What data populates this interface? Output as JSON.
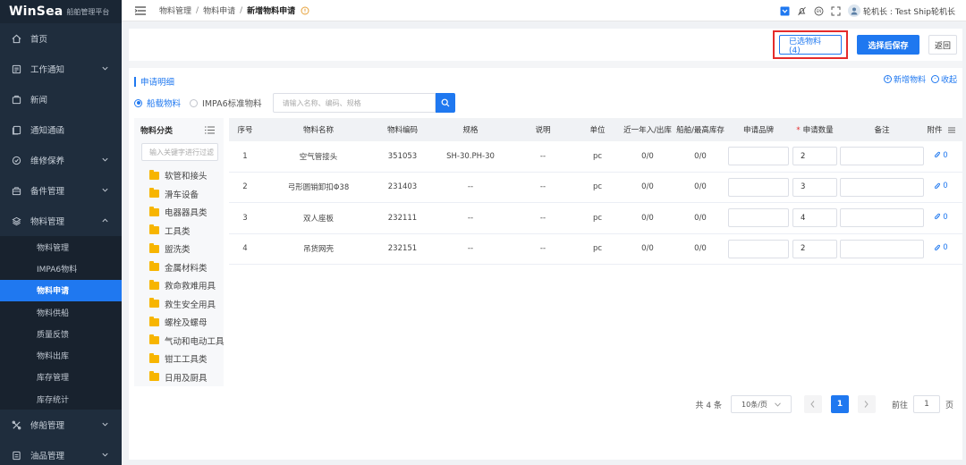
{
  "brand": {
    "logo": "WinSea",
    "subtitle": "船舶管理平台"
  },
  "sidebar": {
    "items": [
      {
        "label": "首页",
        "icon": "home-icon",
        "arrow": false
      },
      {
        "label": "工作通知",
        "icon": "notice-icon",
        "arrow": true
      },
      {
        "label": "新闻",
        "icon": "news-icon",
        "arrow": false
      },
      {
        "label": "通知通函",
        "icon": "circular-icon",
        "arrow": false
      },
      {
        "label": "维修保养",
        "icon": "maintenance-icon",
        "arrow": true
      },
      {
        "label": "备件管理",
        "icon": "spare-parts-icon",
        "arrow": true
      },
      {
        "label": "物料管理",
        "icon": "materials-icon",
        "arrow": true,
        "expanded": true
      }
    ],
    "submenu": [
      {
        "label": "物料管理",
        "active": false
      },
      {
        "label": "IMPA6物料",
        "active": false
      },
      {
        "label": "物料申请",
        "active": true
      },
      {
        "label": "物料供船",
        "active": false
      },
      {
        "label": "质量反馈",
        "active": false
      },
      {
        "label": "物料出库",
        "active": false
      },
      {
        "label": "库存管理",
        "active": false
      },
      {
        "label": "库存统计",
        "active": false
      }
    ],
    "bottom_items": [
      {
        "label": "修船管理",
        "icon": "ship-repair-icon",
        "arrow": true
      },
      {
        "label": "油品管理",
        "icon": "oil-icon",
        "arrow": true
      }
    ]
  },
  "breadcrumb": {
    "items": [
      "物料管理",
      "物料申请",
      "新增物料申请"
    ],
    "separator": "/"
  },
  "topbar": {
    "user": "轮机长 : Test Ship轮机长"
  },
  "actions": {
    "selected_label": "已选物料(4)",
    "save_label": "选择后保存",
    "back_label": "返回"
  },
  "section": {
    "title": "申请明细",
    "add_link": "新增物料",
    "collapse_link": "收起"
  },
  "filter": {
    "options": [
      {
        "label": "船载物料",
        "checked": true
      },
      {
        "label": "IMPA6标准物料",
        "checked": false
      }
    ],
    "search_placeholder": "请输入名称、编码、规格"
  },
  "category": {
    "title": "物料分类",
    "search_placeholder": "输入关键字进行过滤",
    "items": [
      "软管和接头",
      "滑车设备",
      "电器器具类",
      "工具类",
      "盥洗类",
      "金属材料类",
      "救命救难用具",
      "救生安全用具",
      "螺栓及螺母",
      "气动和电动工具",
      "钳工工具类",
      "日用及厨具"
    ]
  },
  "table": {
    "headers": {
      "idx": "序号",
      "name": "物料名称",
      "code": "物料编码",
      "spec": "规格",
      "desc": "说明",
      "unit": "单位",
      "year": "近一年入/出库",
      "max": "船舶/最高库存",
      "brand": "申请品牌",
      "qty": "申请数量",
      "note": "备注",
      "att": "附件"
    },
    "rows": [
      {
        "idx": "1",
        "name": "空气管接头",
        "code": "351053",
        "spec": "SH-30.PH-30",
        "desc": "--",
        "unit": "pc",
        "year": "0/0",
        "max": "0/0",
        "brand": "",
        "qty": "2",
        "note": "",
        "att": "0"
      },
      {
        "idx": "2",
        "name": "弓形圆销卸扣Φ38",
        "code": "231403",
        "spec": "--",
        "desc": "--",
        "unit": "pc",
        "year": "0/0",
        "max": "0/0",
        "brand": "",
        "qty": "3",
        "note": "",
        "att": "0"
      },
      {
        "idx": "3",
        "name": "双人座板",
        "code": "232111",
        "spec": "--",
        "desc": "--",
        "unit": "pc",
        "year": "0/0",
        "max": "0/0",
        "brand": "",
        "qty": "4",
        "note": "",
        "att": "0"
      },
      {
        "idx": "4",
        "name": "吊货网壳",
        "code": "232151",
        "spec": "--",
        "desc": "--",
        "unit": "pc",
        "year": "0/0",
        "max": "0/0",
        "brand": "",
        "qty": "2",
        "note": "",
        "att": "0"
      }
    ]
  },
  "pagination": {
    "total": "共 4 条",
    "page_size": "10条/页",
    "current_page": "1",
    "goto_label": "前往",
    "goto_value": "1",
    "page_unit": "页"
  },
  "colors": {
    "primary": "#1f78f0",
    "sidebar": "#1f2d3d",
    "highlight_border": "#e52b2b",
    "folder": "#f7b500"
  }
}
